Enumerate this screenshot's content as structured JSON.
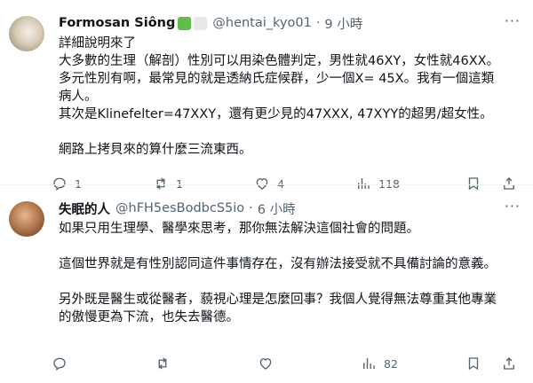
{
  "tweets": [
    {
      "display_name": "Formosan Siông",
      "handle": "@hentai_kyo01",
      "dot": "·",
      "time": "9 小時",
      "lines": [
        "詳細說明來了",
        "大多數的生理（解剖）性別可以用染色體判定，男性就46XY，女性就46XX。",
        "多元性別有啊，最常見的就是透納氏症候群，少一個X= 45X。我有一個這類",
        "病人。",
        "其次是Klinefelter=47XXY，還有更少見的47XXX, 47XYY的超男/超女性。",
        "",
        "網路上拷貝來的算什麼三流東西。"
      ],
      "replies": "1",
      "retweets": "1",
      "likes": "4",
      "views": "118"
    },
    {
      "display_name": "失眠的人",
      "handle": "@hFH5esBodbcS5io",
      "dot": "·",
      "time": "6 小時",
      "lines": [
        "如果只用生理學、醫學來思考，那你無法解決這個社會的問題。",
        "",
        "這個世界就是有性別認同這件事情存在，沒有辦法接受就不具備討論的意義。",
        "",
        "另外既是醫生或從醫者，藐視心理是怎麼回事？我個人覺得無法尊重其他專業",
        "的傲慢更為下流，也失去醫德。"
      ],
      "replies": "",
      "retweets": "",
      "likes": "",
      "views": "82"
    }
  ],
  "more_label": "···",
  "icons": [
    "reply-icon",
    "retweet-icon",
    "like-icon",
    "views-icon",
    "bookmark-icon",
    "share-icon"
  ],
  "colors": {
    "text": "#0f1419",
    "muted": "#536471",
    "divider": "#eff3f4",
    "badge_green": "#5fbd4a"
  }
}
